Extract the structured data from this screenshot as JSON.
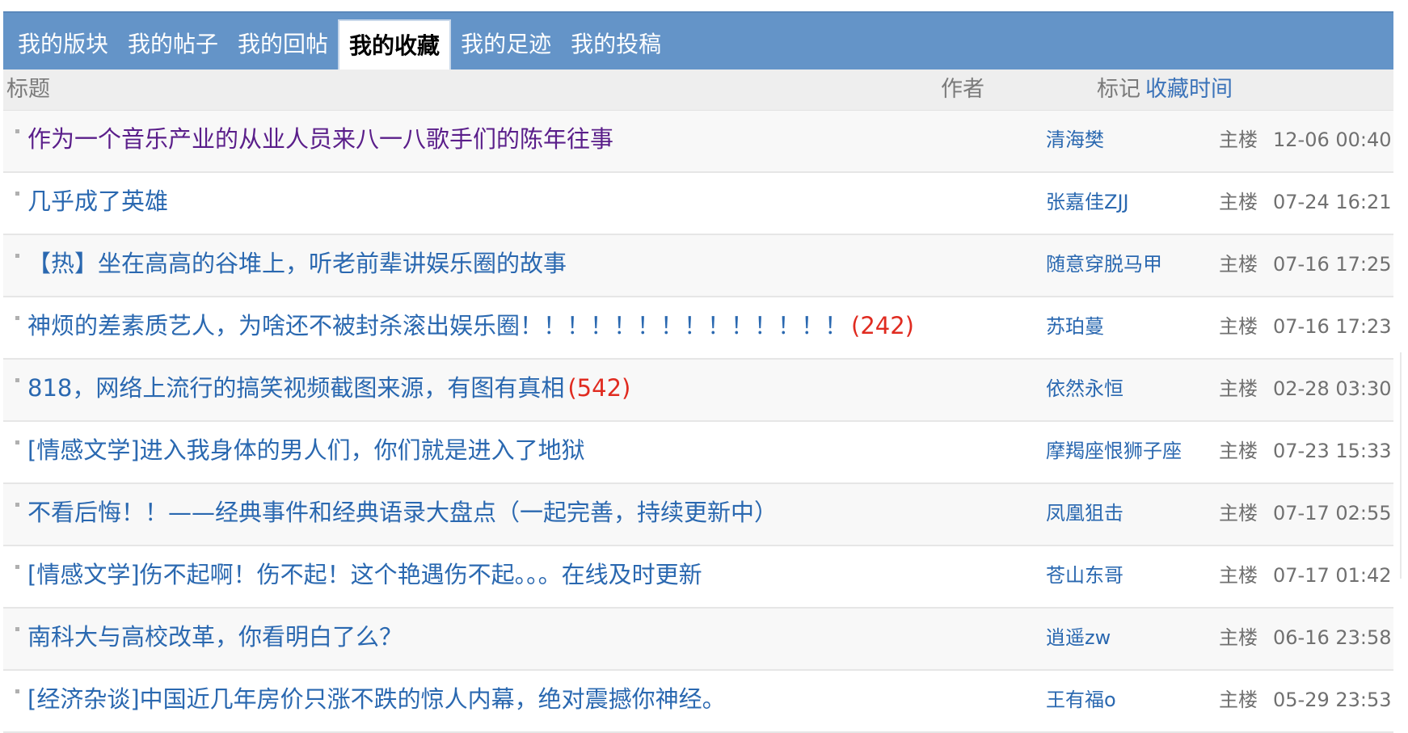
{
  "tabs": [
    {
      "label": "我的版块"
    },
    {
      "label": "我的帖子"
    },
    {
      "label": "我的回帖"
    },
    {
      "label": "我的收藏"
    },
    {
      "label": "我的足迹"
    },
    {
      "label": "我的投稿"
    }
  ],
  "active_tab": "我的收藏",
  "table": {
    "headers": {
      "title": "标题",
      "author": "作者",
      "mark": "标记",
      "time": "收藏时间"
    },
    "rows": [
      {
        "title": "作为一个音乐产业的从业人员来八一八歌手们的陈年往事",
        "count": "",
        "author": "清海樊",
        "mark": "主楼",
        "time": "12-06 00:40"
      },
      {
        "title": "几乎成了英雄",
        "count": "",
        "author": "张嘉佳ZJJ",
        "mark": "主楼",
        "time": "07-24 16:21"
      },
      {
        "title": "【热】坐在高高的谷堆上，听老前辈讲娱乐圈的故事",
        "count": "",
        "author": "随意穿脱马甲",
        "mark": "主楼",
        "time": "07-16 17:25"
      },
      {
        "title": "神烦的差素质艺人，为啥还不被封杀滚出娱乐圈！！！！！！！！！！！！！！",
        "count": "(242)",
        "author": "苏珀蔓",
        "mark": "主楼",
        "time": "07-16 17:23"
      },
      {
        "title": "818，网络上流行的搞笑视频截图来源，有图有真相",
        "count": "(542)",
        "author": "依然永恒",
        "mark": "主楼",
        "time": "02-28 03:30"
      },
      {
        "title": "[情感文学]进入我身体的男人们，你们就是进入了地狱",
        "count": "",
        "author": "摩羯座恨狮子座",
        "mark": "主楼",
        "time": "07-23 15:33"
      },
      {
        "title": "不看后悔！！——经典事件和经典语录大盘点（一起完善，持续更新中）",
        "count": "",
        "author": "凤凰狙击",
        "mark": "主楼",
        "time": "07-17 02:55"
      },
      {
        "title": "[情感文学]伤不起啊！伤不起！这个艳遇伤不起。。。在线及时更新",
        "count": "",
        "author": "苍山东哥",
        "mark": "主楼",
        "time": "07-17 01:42"
      },
      {
        "title": "南科大与高校改革，你看明白了么？",
        "count": "",
        "author": "逍遥zw",
        "mark": "主楼",
        "time": "06-16 23:58"
      },
      {
        "title": "[经济杂谈]中国近几年房价只涨不跌的惊人内幕，绝对震撼你神经。",
        "count": "",
        "author": "王有福o",
        "mark": "主楼",
        "time": "05-29 23:53"
      }
    ]
  },
  "colors": {
    "tab_bar": "#6494c8",
    "link": "#2a68b0",
    "visited_link": "#5a1e8a",
    "count": "#e02b20",
    "header_bg": "#eeeeee"
  }
}
